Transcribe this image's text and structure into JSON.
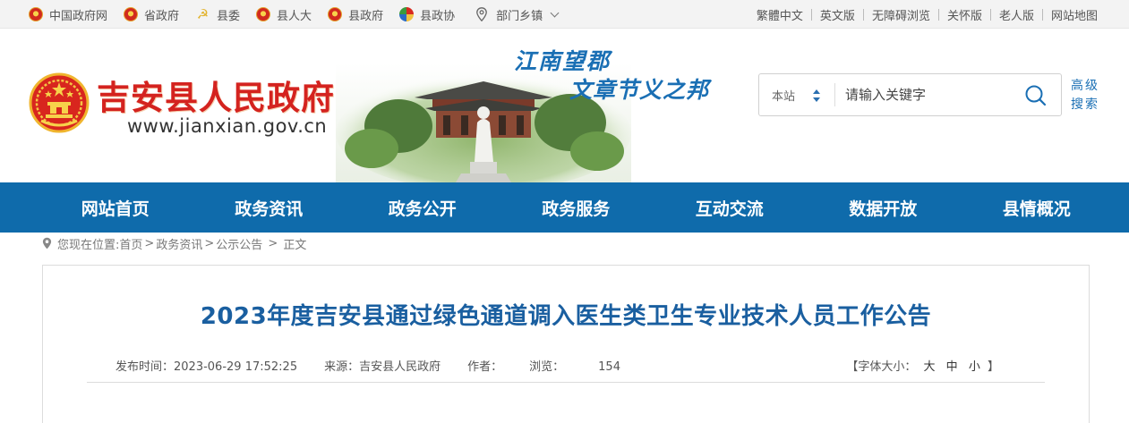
{
  "topbar": {
    "left_links": [
      {
        "label": "中国政府网",
        "icon": "national-emblem-icon"
      },
      {
        "label": "省政府",
        "icon": "national-emblem-icon"
      },
      {
        "label": "县委",
        "icon": "party-emblem-icon"
      },
      {
        "label": "县人大",
        "icon": "national-emblem-icon"
      },
      {
        "label": "县政府",
        "icon": "national-emblem-icon"
      },
      {
        "label": "县政协",
        "icon": "cppcc-emblem-icon"
      }
    ],
    "dept_dropdown": "部门乡镇",
    "right_links": [
      "繁體中文",
      "英文版",
      "无障碍浏览",
      "关怀版",
      "老人版",
      "网站地图"
    ]
  },
  "header": {
    "site_title": "吉安县人民政府",
    "site_url": "www.jianxian.gov.cn",
    "slogan_line1": "江南望郡",
    "slogan_line2": "文章节义之邦"
  },
  "search": {
    "scope": "本站",
    "placeholder": "请输入关键字",
    "advanced": "高级搜索"
  },
  "nav": [
    "网站首页",
    "政务资讯",
    "政务公开",
    "政务服务",
    "互动交流",
    "数据开放",
    "县情概况"
  ],
  "breadcrumb": {
    "prefix": "您现在位置:",
    "items": [
      "首页",
      "政务资讯",
      "公示公告",
      "正文"
    ]
  },
  "article": {
    "title": "2023年度吉安县通过绿色通道调入医生类卫生专业技术人员工作公告",
    "publish_label": "发布时间：",
    "publish_time": "2023-06-29 17:52:25",
    "source_label": "来源：",
    "source": "吉安县人民政府",
    "author_label": "作者：",
    "author": "",
    "views_label": "浏览：",
    "views": "154",
    "font_size_label": "【字体大小：",
    "font_sizes": [
      "大",
      "中",
      "小"
    ],
    "font_size_close": "】"
  },
  "colors": {
    "nav_bg": "#0f6bab",
    "title_red": "#d4231f",
    "article_title_blue": "#1a5fa0",
    "slogan_blue": "#1a6fb4"
  }
}
